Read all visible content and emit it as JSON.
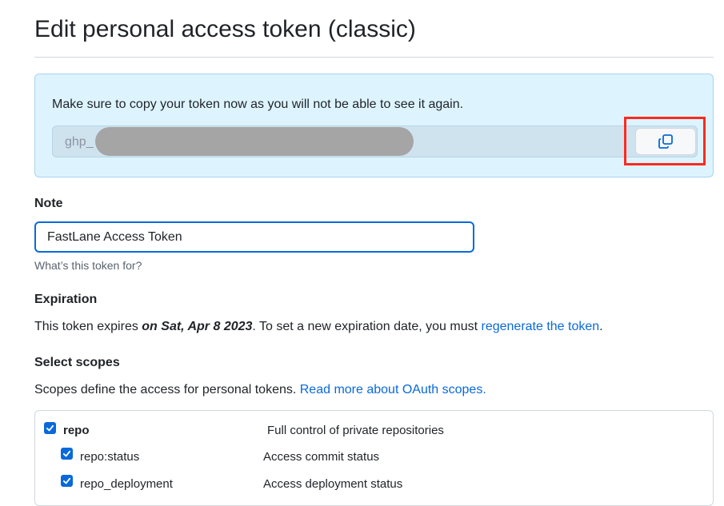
{
  "page": {
    "title": "Edit personal access token (classic)"
  },
  "token_flash": {
    "message": "Make sure to copy your token now as you will not be able to see it again.",
    "token_prefix": "ghp_"
  },
  "note": {
    "label": "Note",
    "value": "FastLane Access Token",
    "hint": "What’s this token for?"
  },
  "expiration": {
    "label": "Expiration",
    "text_before": "This token expires ",
    "date": "on Sat, Apr 8 2023",
    "text_after": ". To set a new expiration date, you must ",
    "link": "regenerate the token",
    "end": "."
  },
  "scopes": {
    "label": "Select scopes",
    "text": "Scopes define the access for personal tokens. ",
    "link": "Read more about OAuth scopes.",
    "items": [
      {
        "name": "repo",
        "description": "Full control of private repositories",
        "checked": true
      },
      {
        "name": "repo:status",
        "description": "Access commit status",
        "checked": true
      },
      {
        "name": "repo_deployment",
        "description": "Access deployment status",
        "checked": true
      }
    ]
  },
  "colors": {
    "link": "#0969da",
    "flash_bg": "#ddf4ff",
    "highlight": "#ff2a1e",
    "checkbox": "#0969da"
  },
  "icons": {
    "copy": "copy-icon",
    "check": "checkmark-icon"
  }
}
